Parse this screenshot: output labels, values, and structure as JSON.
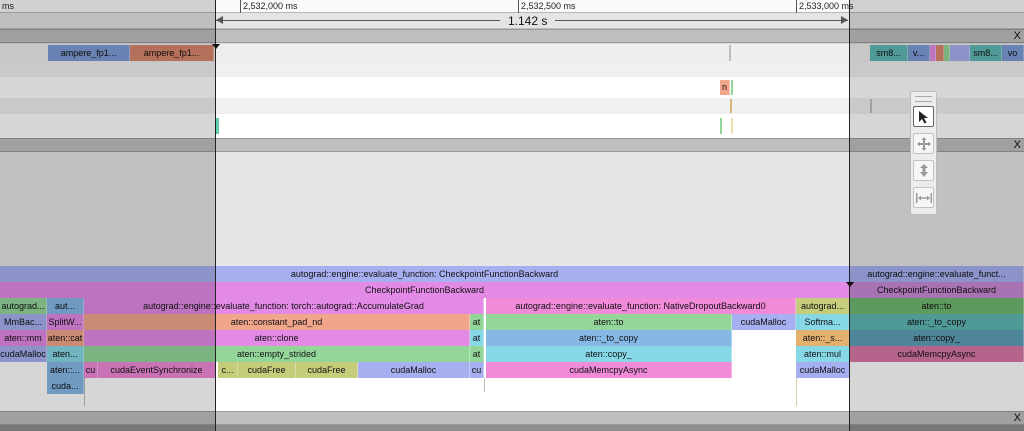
{
  "ruler": {
    "left_label": "ms",
    "ticks": [
      "2,532,000 ms",
      "2,532,500 ms",
      "2,533,000 ms"
    ]
  },
  "selection": {
    "duration": "1.142 s"
  },
  "close_glyph": "X",
  "gpu_events": {
    "ampere_a": "ampere_fp1...",
    "ampere_b": "ampere_fp1...",
    "sm8": "sm8...",
    "v1": "v...",
    "sm8b": "sm8...",
    "vo": "vo",
    "n": "n"
  },
  "flame": {
    "r0": {
      "main": "autograd::engine::evaluate_function: CheckpointFunctionBackward",
      "right": "autograd::engine::evaluate_funct..."
    },
    "r1": {
      "main": "CheckpointFunctionBackward",
      "right": "CheckpointFunctionBackward"
    },
    "r2": {
      "a": "autograd...",
      "b": "aut...",
      "c": "autograd::engine::evaluate_function: torch::autograd::AccumulateGrad",
      "d": "autograd::engine::evaluate_function: NativeDropoutBackward0",
      "e": "autograd...",
      "f": "aten::to"
    },
    "r3": {
      "a": "MmBac...",
      "b": "SplitW...",
      "c": "aten::constant_pad_nd",
      "d": "at",
      "e": "aten::to",
      "f": "cudaMalloc",
      "g": "Softma...",
      "h": "aten::_to_copy"
    },
    "r4": {
      "a": "aten::mm",
      "b": "aten::cat",
      "c": "aten::clone",
      "d": "at",
      "e": "aten::_to_copy",
      "f": "aten::_s...",
      "g": "aten::copy_"
    },
    "r5": {
      "a": "cudaMalloc",
      "b": "aten...",
      "c": "aten::empty_strided",
      "d": "at",
      "e": "aten::copy_",
      "f": "aten::mul",
      "g": "cudaMemcpyAsync"
    },
    "r6": {
      "a": "aten::...",
      "b": "cu",
      "c": "cudaEventSynchronize",
      "d": "c...",
      "e": "cudaFree",
      "f": "cudaFree",
      "g": "cudaMalloc",
      "h": "cu",
      "i": "cudaMemcpyAsync",
      "j": "cudaMalloc"
    },
    "r7": {
      "a": "cuda..."
    }
  },
  "toolbar": {
    "select": "select-tool",
    "pan": "pan-tool",
    "zoom": "zoom-tool",
    "timing": "timing-tool"
  },
  "colors": {
    "blue": "#7d9bd6",
    "salmon": "#d8866e",
    "purple": "#a6b0f0",
    "magenta": "#e38ae6",
    "pink": "#f08ad9",
    "green": "#93d69a",
    "orange": "#f1a58a",
    "cyan": "#86d8e6",
    "teal": "#5fb7b4",
    "olive": "#c5cc7a"
  }
}
